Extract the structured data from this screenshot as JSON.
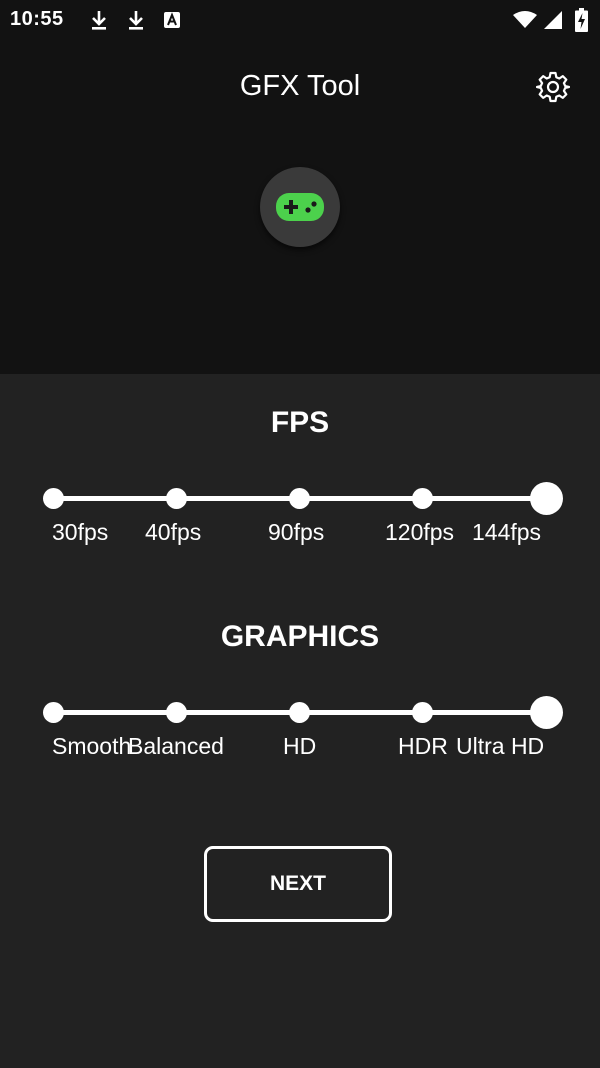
{
  "status_bar": {
    "time": "10:55",
    "left_icons": [
      "download-icon",
      "download-icon",
      "accessibility-icon"
    ],
    "right_icons": [
      "wifi-icon",
      "signal-icon",
      "battery-charging-icon"
    ]
  },
  "app_bar": {
    "title": "GFX Tool",
    "settings_icon": "gear-icon"
  },
  "hero": {
    "icon": "gamepad-icon",
    "icon_color": "#4cd14c"
  },
  "fps": {
    "title": "FPS",
    "options": [
      "30fps",
      "40fps",
      "90fps",
      "120fps",
      "144fps"
    ],
    "selected": "144fps"
  },
  "graphics": {
    "title": "GRAPHICS",
    "options": [
      "Smooth",
      "Balanced",
      "HD",
      "HDR",
      "Ultra HD"
    ],
    "selected": "Ultra HD"
  },
  "next_button": {
    "label": "NEXT"
  },
  "colors": {
    "top_background": "#121212",
    "body_background": "#222222",
    "accent": "#4cd14c",
    "foreground": "#ffffff"
  }
}
